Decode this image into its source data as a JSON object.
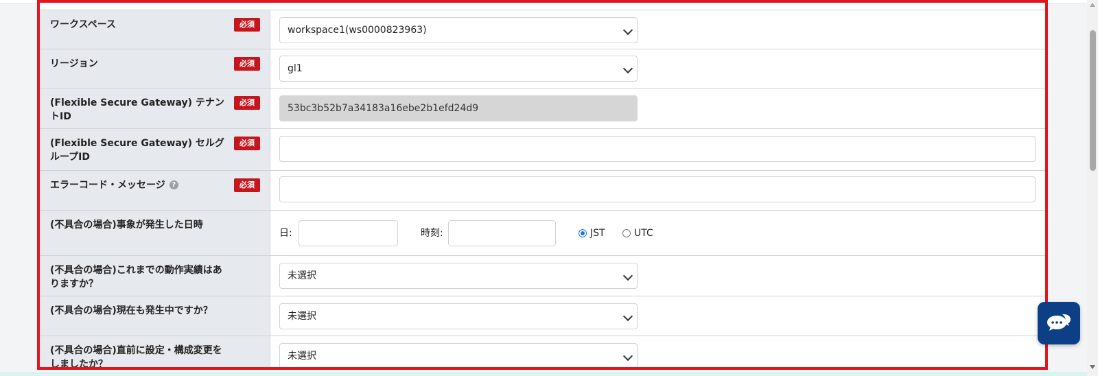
{
  "required_label": "必須",
  "help_glyph": "?",
  "rows": [
    {
      "label": "ワークスペース",
      "required": true,
      "control": "select",
      "value": "workspace1(ws0000823963)"
    },
    {
      "label": "リージョン",
      "required": true,
      "control": "select",
      "value": "gl1"
    },
    {
      "label": "(Flexible Secure Gateway) テナントID",
      "required": true,
      "control": "readonly",
      "value": "53bc3b52b7a34183a16ebe2b1efd24d9"
    },
    {
      "label": "(Flexible Secure Gateway) セルグループID",
      "required": true,
      "control": "text",
      "value": ""
    },
    {
      "label": "エラーコード・メッセージ",
      "required": true,
      "control": "text",
      "value": "",
      "has_help": true
    },
    {
      "label": "(不具合の場合)事象が発生した日時",
      "required": false,
      "control": "datetime"
    },
    {
      "label": "(不具合の場合)これまでの動作実績はありますか？",
      "required": false,
      "control": "select",
      "value": "未選択"
    },
    {
      "label": "(不具合の場合)現在も発生中ですか？",
      "required": false,
      "control": "select",
      "value": "未選択"
    },
    {
      "label": "(不具合の場合)直前に設定・構成変更をしましたか？",
      "required": false,
      "control": "select",
      "value": "未選択"
    }
  ],
  "datetime": {
    "date_label": "日:",
    "time_label": "時刻:",
    "date_value": "",
    "time_value": "",
    "timezones": [
      {
        "label": "JST",
        "checked": true
      },
      {
        "label": "UTC",
        "checked": false
      }
    ]
  },
  "icons": {
    "chat": "chat-bubbles-icon",
    "dropdown": "chevron-down-icon",
    "help": "question-circle-icon"
  },
  "colors": {
    "required_badge": "#c5161d",
    "frame_highlight": "#e0161f",
    "chat_button": "#0c3f86",
    "label_background": "#e6e9ed"
  }
}
